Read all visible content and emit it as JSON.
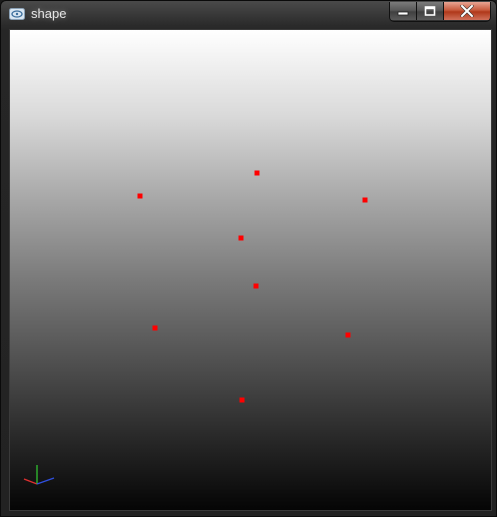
{
  "window": {
    "title": "shape",
    "icon": "app-icon"
  },
  "caption_buttons": [
    {
      "name": "minimize",
      "icon": "minimize-icon"
    },
    {
      "name": "maximize",
      "icon": "maximize-icon"
    },
    {
      "name": "close",
      "icon": "close-icon"
    }
  ],
  "viewport": {
    "background_top": "#ffffff",
    "background_bottom": "#050505",
    "point_color": "#ff0000",
    "point_count": 8
  },
  "axes_gizmo": {
    "x_color": "#e03030",
    "y_color": "#30c030",
    "z_color": "#3050e0"
  }
}
